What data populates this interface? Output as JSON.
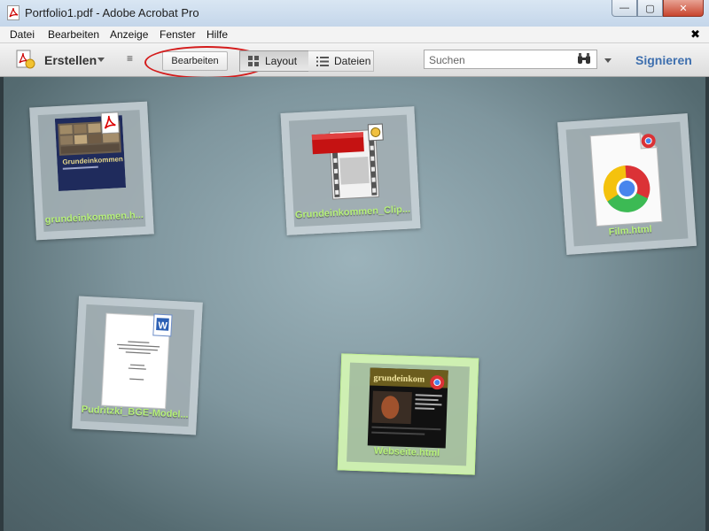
{
  "window": {
    "title": "Portfolio1.pdf - Adobe Acrobat Pro",
    "controls": {
      "minimize": "—",
      "maximize": "▢",
      "close": "✕"
    }
  },
  "menubar": {
    "items": [
      "Datei",
      "Bearbeiten",
      "Anzeige",
      "Fenster",
      "Hilfe"
    ],
    "close": "✖"
  },
  "toolbar": {
    "create_label": "Erstellen",
    "overflow_glyph": "≡",
    "edit_label": "Bearbeiten",
    "layout_label": "Layout",
    "files_label": "Dateien",
    "search_placeholder": "Suchen",
    "sign_label": "Signieren"
  },
  "tiles": [
    {
      "label": "grundeinkommen.h...",
      "type": "pdf",
      "selected": false
    },
    {
      "label": "Grundeinkommen_Clip...",
      "type": "video",
      "selected": false
    },
    {
      "label": "Film.html",
      "type": "html",
      "selected": false
    },
    {
      "label": "Pudritzki_BGE-Model...",
      "type": "word",
      "selected": false
    },
    {
      "label": "Webseite.html",
      "type": "html",
      "selected": true
    }
  ],
  "thumb_text": {
    "book_title": "Grundeinkommen",
    "web_banner": "grundeinkom"
  },
  "colors": {
    "accent_blue": "#3e6fae",
    "highlight_red": "#d41c1c",
    "tile_label_green": "#b6f07a"
  }
}
